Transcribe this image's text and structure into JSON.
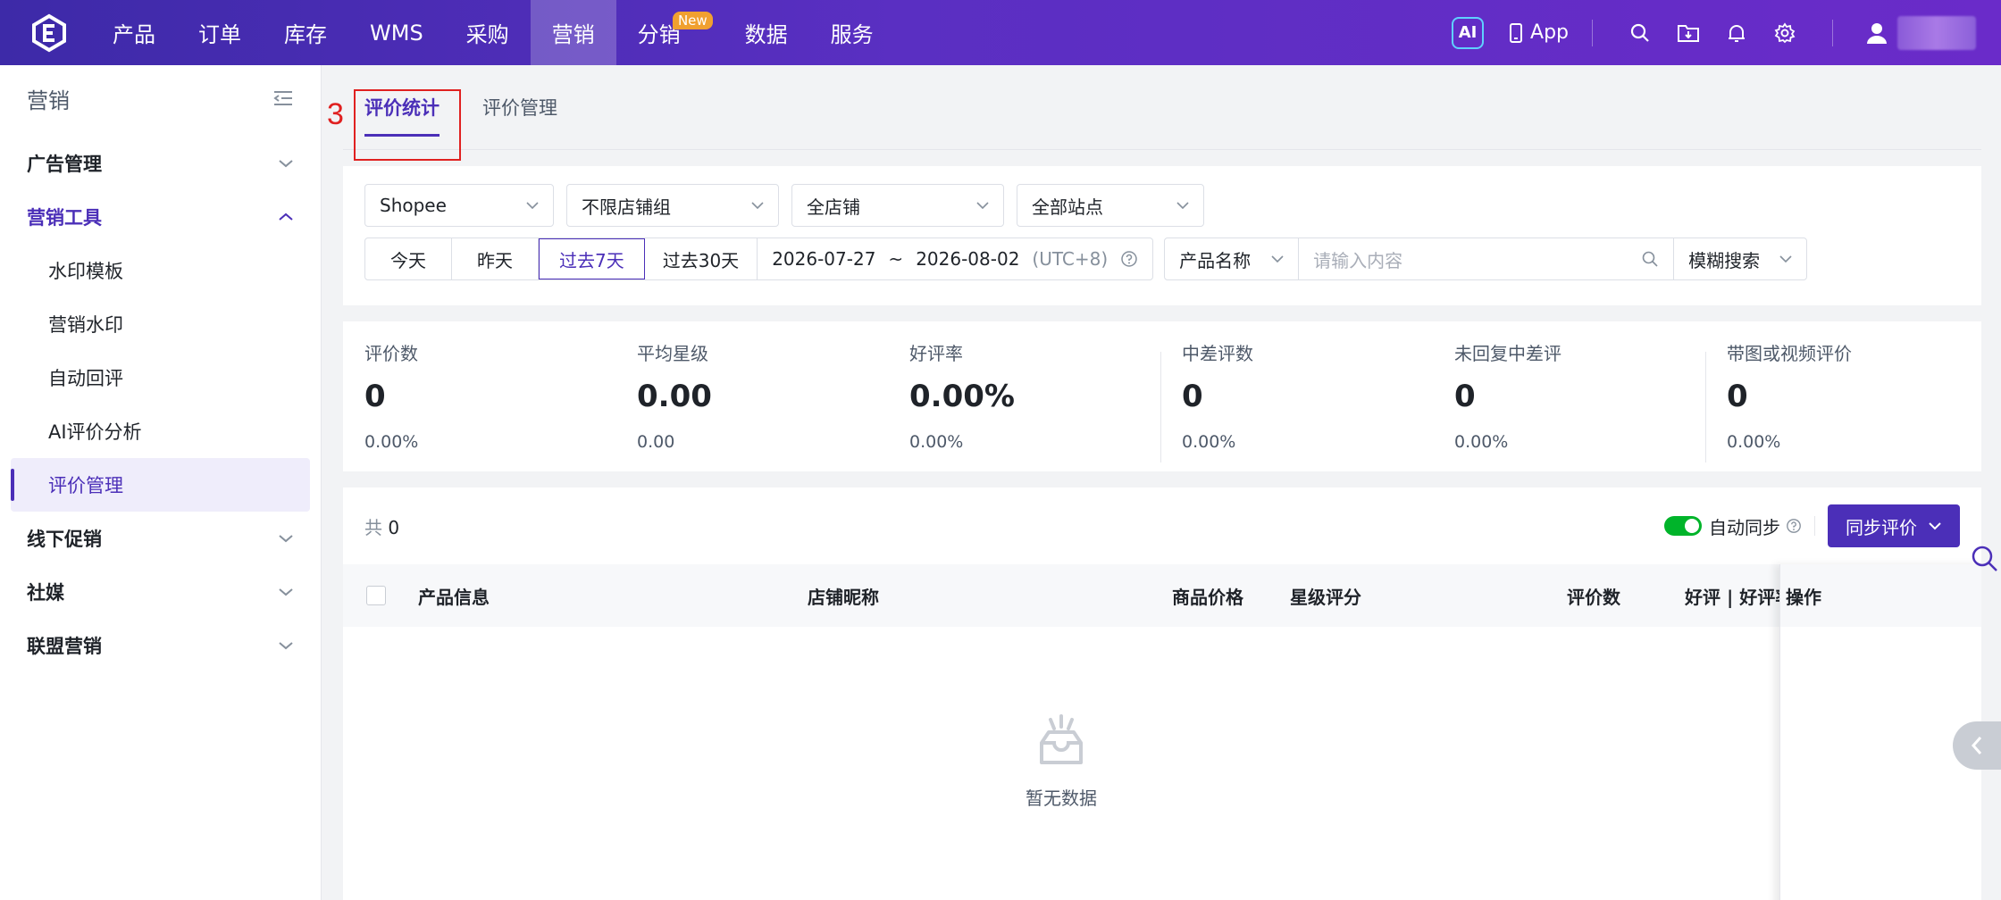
{
  "topnav": {
    "items": [
      {
        "label": "产品"
      },
      {
        "label": "订单"
      },
      {
        "label": "库存"
      },
      {
        "label": "WMS"
      },
      {
        "label": "采购"
      },
      {
        "label": "营销",
        "active": true
      },
      {
        "label": "分销",
        "badge": "New"
      },
      {
        "label": "数据"
      },
      {
        "label": "服务"
      }
    ],
    "ai_label": "AI",
    "app_label": "App",
    "icons": [
      "search-icon",
      "folder-download-icon",
      "bell-icon",
      "gear-icon",
      "user-icon"
    ]
  },
  "sidebar": {
    "title": "营销",
    "groups": [
      {
        "label": "广告管理",
        "expanded": false
      },
      {
        "label": "营销工具",
        "expanded": true,
        "items": [
          "水印模板",
          "营销水印",
          "自动回评",
          "AI评价分析",
          "评价管理"
        ]
      },
      {
        "label": "线下促销",
        "expanded": false
      },
      {
        "label": "社媒",
        "expanded": false
      },
      {
        "label": "联盟营销",
        "expanded": false
      }
    ],
    "active_item": "评价管理"
  },
  "tabs": [
    {
      "label": "评价统计",
      "active": true
    },
    {
      "label": "评价管理",
      "active": false
    }
  ],
  "annotation_step": "3",
  "filters": {
    "platform": "Shopee",
    "shop_group": "不限店铺组",
    "shop": "全店铺",
    "site": "全部站点",
    "date_presets": [
      "今天",
      "昨天",
      "过去7天",
      "过去30天"
    ],
    "active_preset": "过去7天",
    "date_start": "2026-07-27",
    "date_sep": "~",
    "date_end": "2026-08-02",
    "timezone": "(UTC+8)",
    "search_field": "产品名称",
    "search_placeholder": "请输入内容",
    "search_mode": "模糊搜索"
  },
  "stats": [
    {
      "label": "评价数",
      "value": "0",
      "sub": "0.00%"
    },
    {
      "label": "平均星级",
      "value": "0.00",
      "sub": "0.00"
    },
    {
      "label": "好评率",
      "value": "0.00%",
      "sub": "0.00%"
    },
    {
      "label": "中差评数",
      "value": "0",
      "sub": "0.00%"
    },
    {
      "label": "未回复中差评",
      "value": "0",
      "sub": "0.00%"
    },
    {
      "label": "带图或视频评价",
      "value": "0",
      "sub": "0.00%"
    }
  ],
  "table": {
    "total_prefix": "共",
    "total": "0",
    "auto_sync_label": "自动同步",
    "auto_sync_on": true,
    "sync_button": "同步评价",
    "columns": [
      "产品信息",
      "店铺昵称",
      "商品价格",
      "星级评分",
      "评价数",
      "好评 | 好评率"
    ],
    "action_column": "操作",
    "empty_text": "暂无数据"
  }
}
